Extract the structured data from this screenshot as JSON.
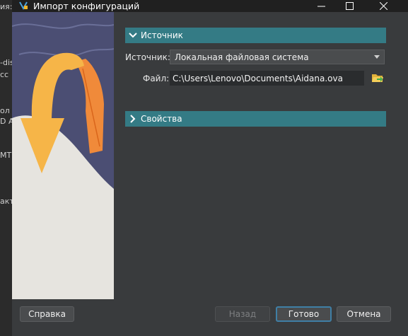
{
  "window": {
    "title": "Импорт конфигураций",
    "controls": {
      "minimize": "—",
      "maximize": "☐",
      "close": "✕"
    }
  },
  "background_window": {
    "fragments": [
      "ия:",
      "-dis",
      "сс",
      "ол",
      "D A",
      "MT",
      "акт"
    ]
  },
  "sections": {
    "source": {
      "label": "Источник",
      "icon": "chevron-down-icon"
    },
    "properties": {
      "label": "Свойства",
      "icon": "chevron-right-icon"
    }
  },
  "source": {
    "label": "Источник:",
    "selected": "Локальная файловая система"
  },
  "file": {
    "label": "Файл:",
    "value": "C:\\Users\\Lenovo\\Documents\\Aidana.ova",
    "button_icon": "folder-open-icon"
  },
  "buttons": {
    "help": "Справка",
    "back": "Назад",
    "finish": "Готово",
    "cancel": "Отмена"
  },
  "colors": {
    "section_header": "#347b85",
    "window_bg": "#393b3d",
    "titlebar_bg": "#202020",
    "default_button_border": "#3f7fa6"
  }
}
